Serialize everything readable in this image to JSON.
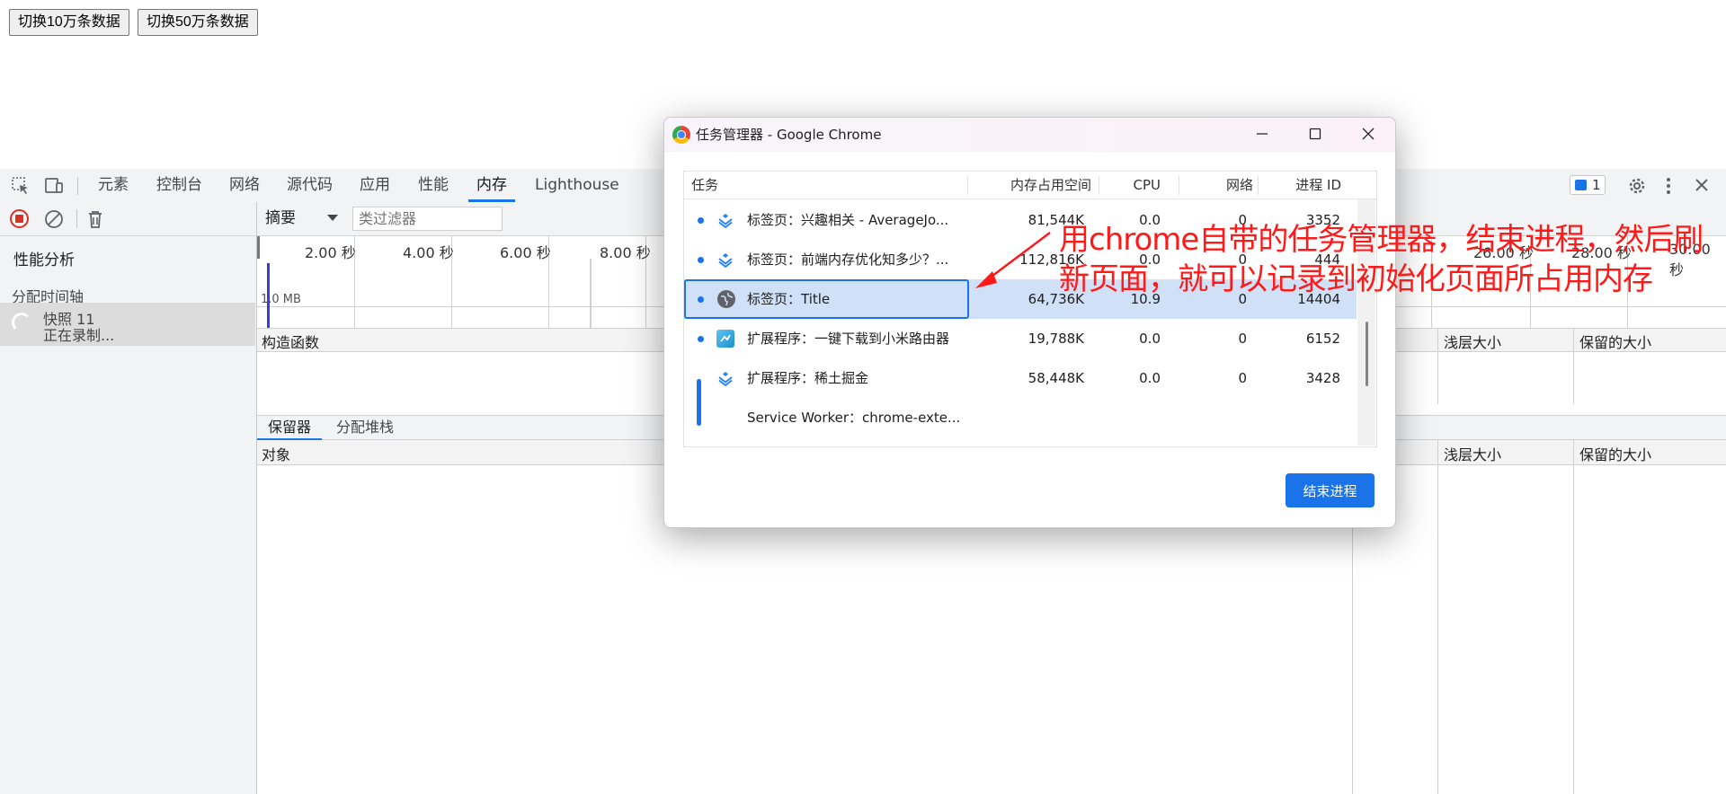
{
  "page": {
    "buttons": [
      "切换10万条数据",
      "切换50万条数据"
    ]
  },
  "devtools": {
    "tabs": [
      "元素",
      "控制台",
      "网络",
      "源代码",
      "应用",
      "性能",
      "内存",
      "Lighthouse"
    ],
    "active_tab": "内存",
    "issues_count": "1",
    "view_select": "摘要",
    "class_filter_placeholder": "类过滤器",
    "sidebar": {
      "heading": "性能分析",
      "section": "分配时间轴",
      "snapshot_name": "快照 11",
      "snapshot_status": "正在录制..."
    },
    "timeline_ticks": [
      "2.00 秒",
      "4.00 秒",
      "6.00 秒",
      "8.00 秒",
      "26.00 秒",
      "28.00 秒",
      "30.00 秒"
    ],
    "timeline_mem_label": "1.0 MB",
    "columns": {
      "constructor": "构造函数",
      "shallow_size": "浅层大小",
      "retained_size": "保留的大小",
      "object": "对象"
    },
    "bottom_tabs": [
      "保留器",
      "分配堆栈"
    ]
  },
  "task_manager": {
    "title": "任务管理器 - Google Chrome",
    "headers": [
      "任务",
      "内存占用空间",
      "CPU",
      "网络",
      "进程 ID"
    ],
    "rows": [
      {
        "task": "标签页：兴趣相关 - AverageJo...",
        "memory": "81,544K",
        "cpu": "0.0",
        "network": "0",
        "pid": "3352",
        "icon": "juejin-icon"
      },
      {
        "task": "标签页：前端内存优化知多少？...",
        "memory": "112,816K",
        "cpu": "0.0",
        "network": "0",
        "pid": "444",
        "icon": "juejin-icon"
      },
      {
        "task": "标签页：Title",
        "memory": "64,736K",
        "cpu": "10.9",
        "network": "0",
        "pid": "14404",
        "icon": "globe-icon"
      },
      {
        "task": "扩展程序：一键下载到小米路由器",
        "memory": "19,788K",
        "cpu": "0.0",
        "network": "0",
        "pid": "6152",
        "icon": "xiaomi-extension-icon"
      },
      {
        "task": "扩展程序：稀土掘金",
        "memory": "58,448K",
        "cpu": "0.0",
        "network": "0",
        "pid": "3428",
        "icon": "juejin-icon"
      },
      {
        "task": "Service Worker：chrome-exte...",
        "memory": "",
        "cpu": "",
        "network": "",
        "pid": "",
        "icon": ""
      }
    ],
    "selected_row": 2,
    "end_process_label": "结束进程"
  },
  "annotation": {
    "text": "用chrome自带的任务管理器，结束进程，然后刷新页面，就可以记录到初始化页面所占用内存",
    "color": "#ff1a1a"
  }
}
